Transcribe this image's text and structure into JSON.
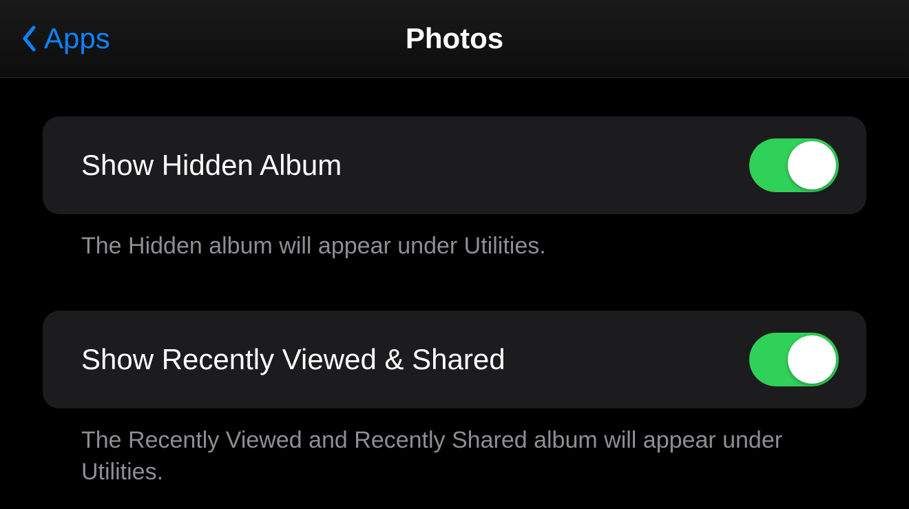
{
  "header": {
    "back_label": "Apps",
    "title": "Photos"
  },
  "settings": {
    "hidden": {
      "label": "Show Hidden Album",
      "enabled": true,
      "footer": "The Hidden album will appear under Utilities."
    },
    "recently": {
      "label": "Show Recently Viewed & Shared",
      "enabled": true,
      "footer": "The Recently Viewed and Recently Shared album will appear under Utilities."
    }
  },
  "colors": {
    "accent": "#0a84ff",
    "toggle_on": "#30d158",
    "secondary_text": "#8e8e93"
  }
}
